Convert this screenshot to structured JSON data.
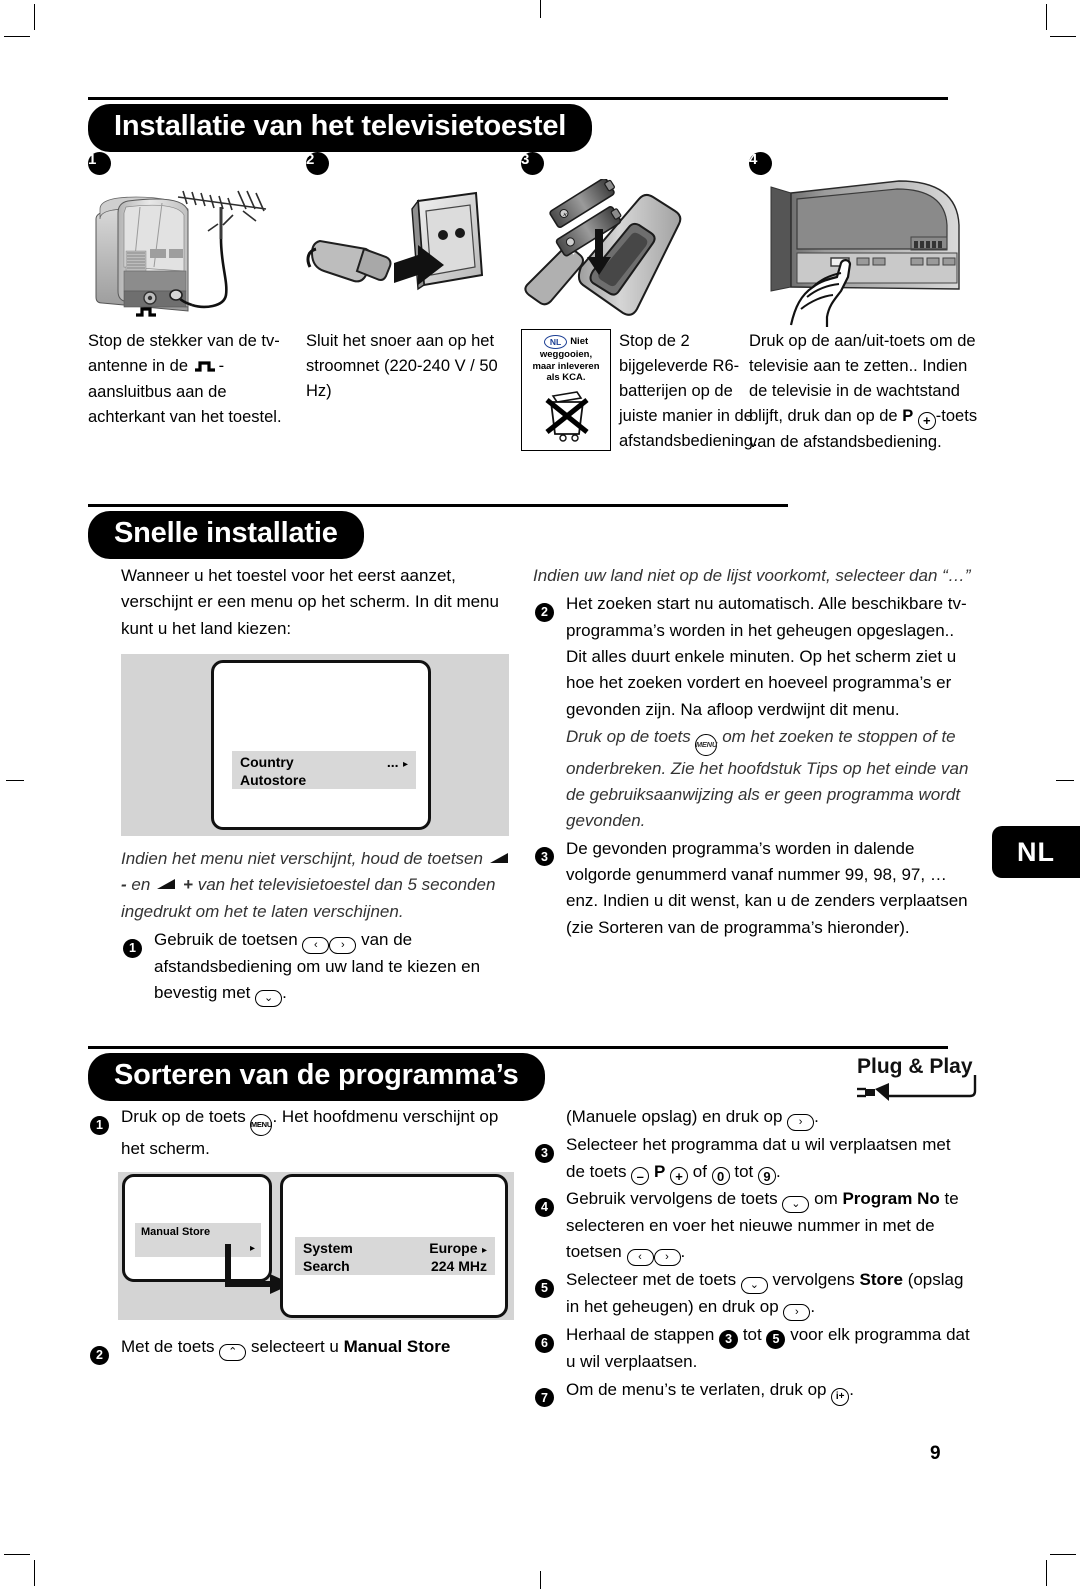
{
  "page": {
    "number": "9",
    "language_tab": "NL"
  },
  "sections": [
    {
      "id": "installatie",
      "title": "Installatie van het televisietoestel",
      "steps": [
        {
          "num": "1",
          "illustration": "tv-with-antenna",
          "text_parts": [
            "Stop de stekker van de tv-antenne in de ",
            "-aansluitbus aan de achterkant van het toestel."
          ]
        },
        {
          "num": "2",
          "illustration": "power-plug-and-socket",
          "text": "Sluit het snoer aan op het stroomnet (220-240 V / 50 Hz)"
        },
        {
          "num": "3",
          "illustration": "remote-control-with-batteries",
          "text": "Stop de 2 bijgeleverde R6-batterijen op de juiste manier in de afstandsbediening.",
          "notice": {
            "badge": "NL",
            "line1": "Niet",
            "line2": "weggooien,",
            "line3": "maar inleveren",
            "line4": "als KCA.",
            "icon": "crossed-out-wheelie-bin-icon"
          },
          "text_tail": "afstandsbediening."
        },
        {
          "num": "4",
          "illustration": "hand-pressing-tv-power-button",
          "text_a": "Druk op de aan/uit-toets om de televisie aan te zetten.. Indien de televisie in de wachtstand blijft, druk dan op de ",
          "key_p": "P",
          "key_plus": "+",
          "text_b": "-toets van de afstandsbediening."
        }
      ]
    },
    {
      "id": "snelle-installatie",
      "title": "Snelle installatie",
      "logo": "Plug & Play",
      "left": {
        "intro": "Wanneer u het toestel voor het eerst aanzet, verschijnt er een menu op het scherm. In dit menu kunt u het land kiezen:",
        "screen": {
          "rows": [
            {
              "label": "Country",
              "value": "...",
              "arrow": "▸"
            },
            {
              "label": "Autostore",
              "value": "",
              "arrow": ""
            }
          ]
        },
        "note_a": "Indien het menu niet verschijnt, houd de toetsen",
        "note_key_minus": "-",
        "note_mid": " en ",
        "note_key_plus": "+",
        "note_b": " van het televisietoestel dan 5 seconden ingedrukt om het te laten verschijnen.",
        "step1_num": "1",
        "step1_a": "Gebruik de toetsen ",
        "step1_keys": [
          "‹",
          "›"
        ],
        "step1_b": " van de afstandsbediening om uw land te kiezen en bevestig met ",
        "step1_key_end": "⌄",
        "step1_c": "."
      },
      "right": {
        "note_top": "Indien uw land niet op de lijst voorkomt, selecteer dan “…”",
        "step2_num": "2",
        "step2_text": "Het zoeken start nu automatisch. Alle beschikbare tv-programma’s worden in het geheugen opgeslagen.. Dit alles duurt enkele minuten. Op het scherm ziet u hoe het zoeken vordert en hoeveel programma’s er gevonden zijn. Na afloop verdwijnt dit menu.",
        "step2_note_a": "Druk op de toets ",
        "step2_note_key": "MENU",
        "step2_note_b": " om het zoeken te stoppen of te onderbreken. Zie het hoofdstuk Tips op het einde van de gebruiksaanwijzing als er geen programma wordt gevonden.",
        "step3_num": "3",
        "step3_text": "De gevonden programma’s worden in dalende volgorde genummerd vanaf nummer 99, 98, 97, …enz. Indien u dit wenst, kan u de zenders verplaatsen (zie Sorteren van de programma’s hieronder)."
      }
    },
    {
      "id": "sorteren",
      "title": "Sorteren van de programma’s",
      "left": {
        "step1_num": "1",
        "step1_a": "Druk op de toets ",
        "step1_key": "MENU",
        "step1_b": ". Het hoofdmenu verschijnt op het scherm.",
        "screen_left": {
          "rows": [
            {
              "label": "Manual Store",
              "arrow": "▸"
            }
          ]
        },
        "screen_right": {
          "rows": [
            {
              "label": "System",
              "value": "Europe",
              "arrow": "▸"
            },
            {
              "label": "Search",
              "value": "224 MHz",
              "arrow": ""
            }
          ]
        },
        "step2_num": "2",
        "step2_a": "Met de toets ",
        "step2_key": "⌃",
        "step2_b": " selecteert u ",
        "step2_bold": "Manual Store"
      },
      "right": {
        "cont_a": "(Manuele opslag) en druk op ",
        "cont_key": "›",
        "cont_b": ".",
        "step3_num": "3",
        "step3_a": "Selecteer het programma dat u wil verplaatsen met de toets ",
        "step3_key_minus": "–",
        "step3_p": "P",
        "step3_key_plus": "+",
        "step3_mid": " of ",
        "step3_key_0": "0",
        "step3_tot": " tot ",
        "step3_key_9": "9",
        "step3_end": ".",
        "step4_num": "4",
        "step4_a": "Gebruik vervolgens de toets ",
        "step4_key": "⌄",
        "step4_b": " om ",
        "step4_bold": "Program No",
        "step4_c": " te selecteren en voer het nieuwe nummer in met de toetsen ",
        "step4_keys": [
          "‹",
          "›"
        ],
        "step4_d": ".",
        "step5_num": "5",
        "step5_a": "Selecteer met de toets ",
        "step5_key": "⌄",
        "step5_b": " vervolgens ",
        "step5_bold": "Store",
        "step5_c": " (opslag in het geheugen) en druk op ",
        "step5_key2": "›",
        "step5_d": ".",
        "step6_num": "6",
        "step6_a": "Herhaal de stappen ",
        "step6_n1": "3",
        "step6_mid": " tot ",
        "step6_n2": "5",
        "step6_b": " voor elk programma dat u wil verplaatsen.",
        "step7_num": "7",
        "step7_a": "Om de menu’s te verlaten, druk op ",
        "step7_key": "i+",
        "step7_b": "."
      }
    }
  ]
}
